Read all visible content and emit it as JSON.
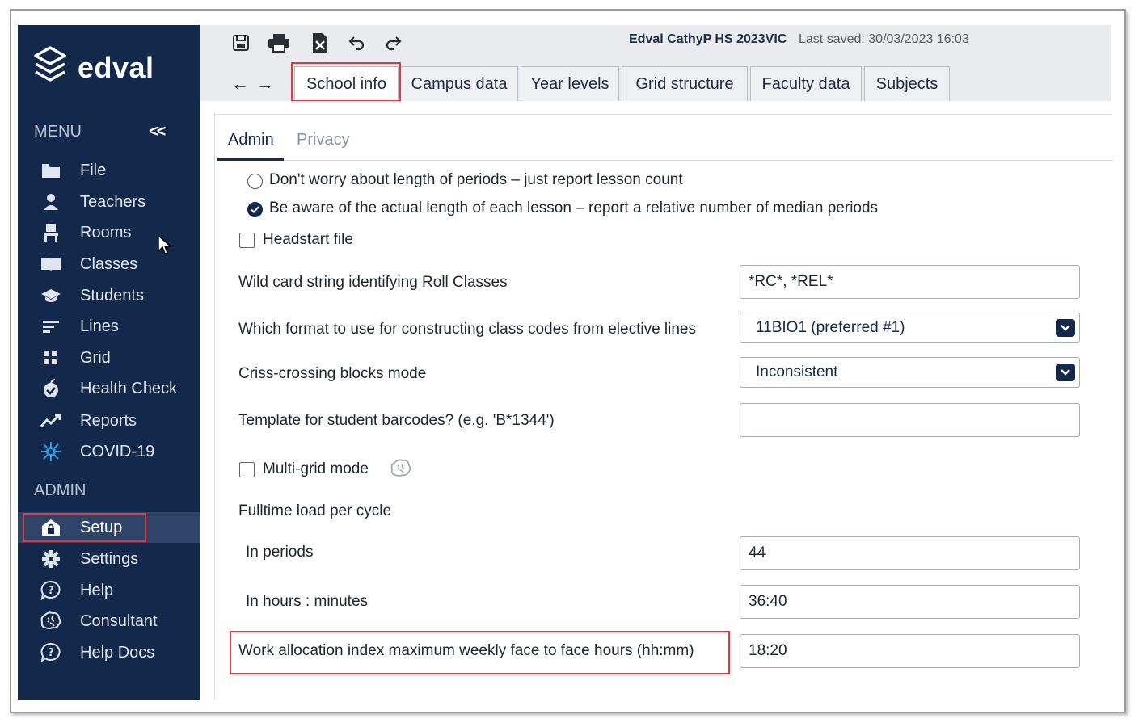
{
  "app": {
    "brand": "edval"
  },
  "sidebar": {
    "menu_title": "MENU",
    "collapse_label": "<<",
    "admin_title": "ADMIN",
    "menu_items": [
      {
        "label": "File",
        "icon": "folder-icon"
      },
      {
        "label": "Teachers",
        "icon": "person-icon"
      },
      {
        "label": "Rooms",
        "icon": "chair-icon"
      },
      {
        "label": "Classes",
        "icon": "book-icon"
      },
      {
        "label": "Students",
        "icon": "graduation-cap-icon"
      },
      {
        "label": "Lines",
        "icon": "lines-icon"
      },
      {
        "label": "Grid",
        "icon": "grid-icon"
      },
      {
        "label": "Health Check",
        "icon": "apple-icon"
      },
      {
        "label": "Reports",
        "icon": "chart-line-icon"
      },
      {
        "label": "COVID-19",
        "icon": "virus-icon"
      }
    ],
    "admin_items": [
      {
        "label": "Setup",
        "icon": "house-lock-icon",
        "active": true
      },
      {
        "label": "Settings",
        "icon": "gear-icon"
      },
      {
        "label": "Help",
        "icon": "help-bubble-icon"
      },
      {
        "label": "Consultant",
        "icon": "brain-icon"
      },
      {
        "label": "Help Docs",
        "icon": "help-bubble-icon"
      }
    ]
  },
  "toolbar": {
    "document_title": "Edval CathyP HS 2023VIC",
    "last_saved": "Last saved: 30/03/2023 16:03",
    "back_label": "←",
    "forward_label": "→"
  },
  "tabs": [
    {
      "label": "School info",
      "active": true
    },
    {
      "label": "Campus data"
    },
    {
      "label": "Year levels"
    },
    {
      "label": "Grid structure"
    },
    {
      "label": "Faculty data"
    },
    {
      "label": "Subjects"
    }
  ],
  "subtabs": [
    {
      "label": "Admin",
      "active": true
    },
    {
      "label": "Privacy"
    }
  ],
  "form": {
    "radio_period_count": "Don't worry about length of periods – just report lesson count",
    "radio_period_length": "Be aware of the actual length of each lesson – report a relative number of median periods",
    "headstart_label": "Headstart file",
    "roll_classes_label": "Wild card string identifying Roll Classes",
    "roll_classes_value": "*RC*, *REL*",
    "class_codes_label": "Which format to use for constructing class codes from elective lines",
    "class_codes_value": "11BIO1 (preferred #1)",
    "criss_cross_label": "Criss-crossing blocks mode",
    "criss_cross_value": "Inconsistent",
    "barcode_label": "Template for student barcodes? (e.g. 'B*1344')",
    "barcode_value": "",
    "multigrid_label": "Multi-grid mode",
    "fulltime_label": "Fulltime load per cycle",
    "periods_label": "In periods",
    "periods_value": "44",
    "hours_label": "In hours : minutes",
    "hours_value": "36:40",
    "wai_label": "Work allocation index maximum weekly face to face hours (hh:mm)",
    "wai_value": "18:20"
  },
  "colors": {
    "sidebar_bg": "#13294b",
    "highlight": "#e0393e",
    "toolbar_bg": "#e9ebee"
  }
}
